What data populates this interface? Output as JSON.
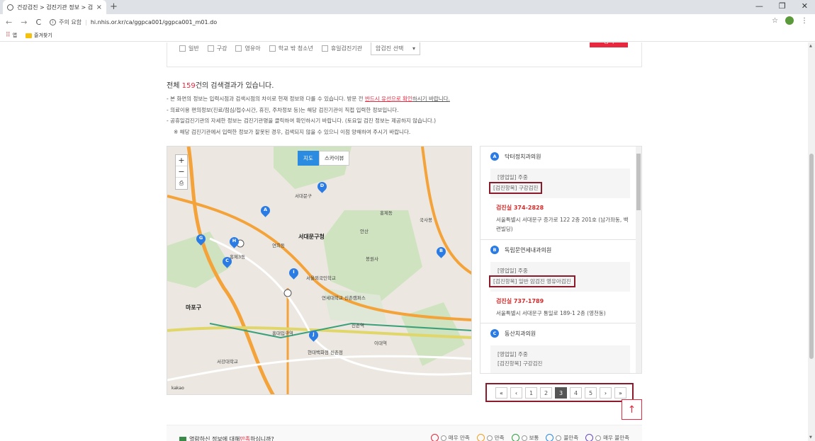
{
  "browser": {
    "tab_title": "건강검진 > 검진기관 정보 > 검",
    "new_tab": "+",
    "close": "×",
    "security_label": "주의 요함",
    "url": "hi.nhis.or.kr/ca/ggpca001/ggpca001_m01.do",
    "bookmarks": {
      "apps": "앱",
      "favorites": "즐겨찾기"
    },
    "window_controls": [
      "—",
      "❐",
      "✕"
    ]
  },
  "filter": {
    "checkboxes": [
      "일반",
      "구강",
      "영유아",
      "학교 밖 청소년",
      "휴일검진기관"
    ],
    "select_value": "암검진 선택",
    "search_label": "검색"
  },
  "results": {
    "prefix": "전체 ",
    "count": "159",
    "suffix": "건의 검색결과가 있습니다.",
    "notes": [
      "- 본 화면의 정보는 입력시점과 검색시점의 차이로 현재 정보와 다를 수 있습니다.  방문 전",
      "반드시 유선으로 확인",
      "하시기 바랍니다.",
      "- 의료이용 편의정보(진료/점심/접수시간, 휴진, 주차정보 등)는 해당 검진기관이 직접 입력한 정보입니다.",
      "- 공휴일검진기관의 자세한 정보는 검진기관명을 클릭하여 확인하시기 바랍니다. (토요일 검진 정보는 제공하지 않습니다.)",
      "※ 해당 검진기관에서 입력한 정보가 잘못된 경우, 검색되지 않을 수 있으니 이점 양해하여 주시기 바랍니다."
    ]
  },
  "map": {
    "type_map": "지도",
    "type_skyview": "스카이뷰",
    "zoom_in": "+",
    "zoom_out": "−",
    "print": "⎙",
    "logo": "kakao",
    "pins": [
      "A",
      "B",
      "C",
      "D",
      "G",
      "H",
      "I",
      "J"
    ],
    "labels": [
      "서대문구청",
      "서대문구",
      "홍제동",
      "홍제3동",
      "국사봉",
      "안산",
      "봉원사",
      "연희동",
      "신촌역",
      "이대역",
      "홍대입구역",
      "마포구",
      "현대백화점 신촌점",
      "연세대학교 신촌캠퍼스",
      "서울외국인학교",
      "서강대학교"
    ]
  },
  "list": [
    {
      "marker": "A",
      "name": "닥터정치과의원",
      "hours": "[영업일] 주중",
      "items": "[검진항목] 구강검진",
      "phone": "검진실  374-2828",
      "address": "서울특별시 서대문구 증가로 122 2층 201호 (남가좌동, 백련빌딩)"
    },
    {
      "marker": "B",
      "name": "독립문연세내과의원",
      "hours": "[영업일] 주중",
      "items": "[검진항목] 일반 암검진 영유아검진",
      "phone": "검진실  737-1789",
      "address": "서울특별시 서대문구 통일로 189-1 2층 (영천동)"
    },
    {
      "marker": "C",
      "name": "동산치과의원",
      "hours": "[영업일] 주중",
      "items": "[검진항목] 구강검진",
      "phone": "",
      "address": ""
    }
  ],
  "pagination": {
    "first": "«",
    "prev": "‹",
    "pages": [
      "1",
      "2",
      "3",
      "4",
      "5"
    ],
    "current": "3",
    "next": "›",
    "last": "»"
  },
  "to_top": "↑",
  "survey": {
    "question_pre": "열람하신 정보에 대해 ",
    "question_red": "만족",
    "question_post": "하십니까?",
    "options": [
      "매우 만족",
      "만족",
      "보통",
      "불만족",
      "매우 불만족"
    ],
    "colors": [
      "#e8283e",
      "#f0a020",
      "#30a040",
      "#2b8be0",
      "#6a4ac0"
    ]
  }
}
